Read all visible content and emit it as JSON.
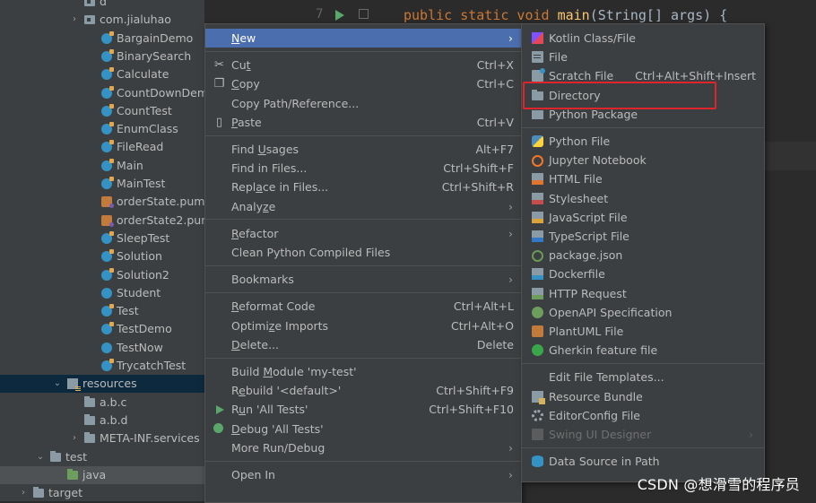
{
  "code": {
    "line_number": "7",
    "keywords": "public static void ",
    "method": "main",
    "rest": "(String[] args) {"
  },
  "project_tree": [
    {
      "label": "d",
      "icon": "package-folder-icon",
      "indent": 1,
      "arrow": ""
    },
    {
      "label": "com.jialuhao",
      "icon": "package-folder-icon",
      "indent": 1,
      "arrow": "›"
    },
    {
      "label": "BargainDemo",
      "icon": "java-class-runnable-icon",
      "indent": 2,
      "arrow": ""
    },
    {
      "label": "BinarySearch",
      "icon": "java-class-runnable-icon",
      "indent": 2,
      "arrow": ""
    },
    {
      "label": "Calculate",
      "icon": "java-class-runnable-icon",
      "indent": 2,
      "arrow": ""
    },
    {
      "label": "CountDownDemo",
      "icon": "java-class-runnable-icon",
      "indent": 2,
      "arrow": ""
    },
    {
      "label": "CountTest",
      "icon": "java-class-runnable-icon",
      "indent": 2,
      "arrow": ""
    },
    {
      "label": "EnumClass",
      "icon": "java-class-runnable-icon",
      "indent": 2,
      "arrow": ""
    },
    {
      "label": "FileRead",
      "icon": "java-class-runnable-icon",
      "indent": 2,
      "arrow": ""
    },
    {
      "label": "Main",
      "icon": "java-class-runnable-icon",
      "indent": 2,
      "arrow": ""
    },
    {
      "label": "MainTest",
      "icon": "java-class-runnable-icon",
      "indent": 2,
      "arrow": ""
    },
    {
      "label": "orderState.puml",
      "icon": "puml-file-icon",
      "indent": 2,
      "arrow": ""
    },
    {
      "label": "orderState2.puml",
      "icon": "puml-file-icon",
      "indent": 2,
      "arrow": ""
    },
    {
      "label": "SleepTest",
      "icon": "java-class-runnable-icon",
      "indent": 2,
      "arrow": ""
    },
    {
      "label": "Solution",
      "icon": "java-class-runnable-icon",
      "indent": 2,
      "arrow": ""
    },
    {
      "label": "Solution2",
      "icon": "java-class-runnable-icon",
      "indent": 2,
      "arrow": ""
    },
    {
      "label": "Student",
      "icon": "java-class-icon",
      "indent": 2,
      "arrow": ""
    },
    {
      "label": "Test",
      "icon": "java-class-runnable-icon",
      "indent": 2,
      "arrow": ""
    },
    {
      "label": "TestDemo",
      "icon": "java-class-runnable-icon",
      "indent": 2,
      "arrow": ""
    },
    {
      "label": "TestNow",
      "icon": "java-class-icon",
      "indent": 2,
      "arrow": ""
    },
    {
      "label": "TrycatchTest",
      "icon": "java-class-runnable-icon",
      "indent": 2,
      "arrow": ""
    },
    {
      "label": "resources",
      "icon": "resources-folder-icon",
      "indent": 0,
      "arrow": "⌄",
      "selected": true
    },
    {
      "label": "a.b.c",
      "icon": "folder-icon",
      "indent": 1,
      "arrow": ""
    },
    {
      "label": "a.b.d",
      "icon": "folder-icon",
      "indent": 1,
      "arrow": ""
    },
    {
      "label": "META-INF.services",
      "icon": "folder-icon",
      "indent": 1,
      "arrow": "›"
    },
    {
      "label": "test",
      "icon": "folder-icon",
      "indent": -1,
      "arrow": "⌄"
    },
    {
      "label": "java",
      "icon": "test-source-folder-icon",
      "indent": 0,
      "arrow": "",
      "java": true
    },
    {
      "label": "target",
      "icon": "target-folder-icon",
      "indent": -2,
      "arrow": "›"
    }
  ],
  "context_menu": [
    {
      "label": "New",
      "mnemonic": "N",
      "shortcut": "",
      "submenu": true,
      "highlighted": true,
      "icon": ""
    },
    {
      "sep": true
    },
    {
      "label": "Cut",
      "mnemonic": "t",
      "shortcut": "Ctrl+X",
      "icon": "cut-icon"
    },
    {
      "label": "Copy",
      "mnemonic": "C",
      "shortcut": "Ctrl+C",
      "icon": "copy-icon"
    },
    {
      "label": "Copy Path/Reference...",
      "shortcut": ""
    },
    {
      "label": "Paste",
      "mnemonic": "P",
      "shortcut": "Ctrl+V",
      "icon": "paste-icon"
    },
    {
      "sep": true
    },
    {
      "label": "Find Usages",
      "mnemonic": "U",
      "shortcut": "Alt+F7"
    },
    {
      "label": "Find in Files...",
      "shortcut": "Ctrl+Shift+F"
    },
    {
      "label": "Replace in Files...",
      "mnemonic": "a",
      "shortcut": "Ctrl+Shift+R"
    },
    {
      "label": "Analyze",
      "mnemonic": "z",
      "submenu": true
    },
    {
      "sep": true
    },
    {
      "label": "Refactor",
      "mnemonic": "R",
      "submenu": true
    },
    {
      "label": "Clean Python Compiled Files",
      "shortcut": ""
    },
    {
      "sep": true
    },
    {
      "label": "Bookmarks",
      "submenu": true
    },
    {
      "sep": true
    },
    {
      "label": "Reformat Code",
      "mnemonic": "R",
      "shortcut": "Ctrl+Alt+L"
    },
    {
      "label": "Optimize Imports",
      "mnemonic": "z",
      "shortcut": "Ctrl+Alt+O"
    },
    {
      "label": "Delete...",
      "mnemonic": "D",
      "shortcut": "Delete"
    },
    {
      "sep": true
    },
    {
      "label": "Build Module 'my-test'",
      "mnemonic": "M",
      "shortcut": ""
    },
    {
      "label": "Rebuild '<default>'",
      "mnemonic": "e",
      "shortcut": "Ctrl+Shift+F9"
    },
    {
      "label": "Run 'All Tests'",
      "mnemonic": "u",
      "shortcut": "Ctrl+Shift+F10",
      "icon": "run-icon"
    },
    {
      "label": "Debug 'All Tests'",
      "mnemonic": "D",
      "shortcut": "",
      "icon": "debug-icon"
    },
    {
      "label": "More Run/Debug",
      "submenu": true
    },
    {
      "sep": true
    },
    {
      "label": "Open In",
      "submenu": true
    }
  ],
  "new_submenu": [
    {
      "label": "Kotlin Class/File",
      "icon": "kotlin-icon",
      "cls": "i-kotlin"
    },
    {
      "label": "File",
      "icon": "file-icon",
      "cls": "i-file"
    },
    {
      "label": "Scratch File",
      "shortcut": "Ctrl+Alt+Shift+Insert",
      "icon": "scratch-file-icon",
      "cls": "i-scratch"
    },
    {
      "label": "Directory",
      "icon": "directory-icon",
      "cls": "i-dir"
    },
    {
      "label": "Python Package",
      "icon": "python-package-icon",
      "cls": "i-pypkg"
    },
    {
      "sep": true
    },
    {
      "label": "Python File",
      "icon": "python-icon",
      "cls": "i-py"
    },
    {
      "label": "Jupyter Notebook",
      "icon": "jupyter-icon",
      "cls": "i-jup"
    },
    {
      "label": "HTML File",
      "icon": "html-icon",
      "cls": "i-html"
    },
    {
      "label": "Stylesheet",
      "icon": "css-icon",
      "cls": "i-css"
    },
    {
      "label": "JavaScript File",
      "icon": "javascript-icon",
      "cls": "i-js"
    },
    {
      "label": "TypeScript File",
      "icon": "typescript-icon",
      "cls": "i-ts"
    },
    {
      "label": "package.json",
      "icon": "package-json-icon",
      "cls": "i-pkgjson"
    },
    {
      "label": "Dockerfile",
      "icon": "docker-icon",
      "cls": "i-docker"
    },
    {
      "label": "HTTP Request",
      "icon": "http-request-icon",
      "cls": "i-http"
    },
    {
      "label": "OpenAPI Specification",
      "icon": "openapi-icon",
      "cls": "i-openapi"
    },
    {
      "label": "PlantUML File",
      "icon": "plantuml-icon",
      "cls": "i-plantuml"
    },
    {
      "label": "Gherkin feature file",
      "icon": "gherkin-icon",
      "cls": "i-gherkin"
    },
    {
      "sep": true
    },
    {
      "label": "Edit File Templates...",
      "icon": "",
      "cls": ""
    },
    {
      "label": "Resource Bundle",
      "icon": "resource-bundle-icon",
      "cls": "i-bundle"
    },
    {
      "label": "EditorConfig File",
      "icon": "editorconfig-gear-icon",
      "cls": "i-gear"
    },
    {
      "label": "Swing UI Designer",
      "icon": "swing-icon",
      "cls": "i-swing",
      "disabled": true,
      "submenu": true
    },
    {
      "sep": true
    },
    {
      "label": "Data Source in Path",
      "icon": "database-icon",
      "cls": "i-db"
    }
  ],
  "watermark": "CSDN @想滑雪的程序员",
  "colors": {
    "highlight": "#4b6eaf",
    "annotation_box": "#e0242c",
    "menu_bg": "#3c3f41"
  }
}
